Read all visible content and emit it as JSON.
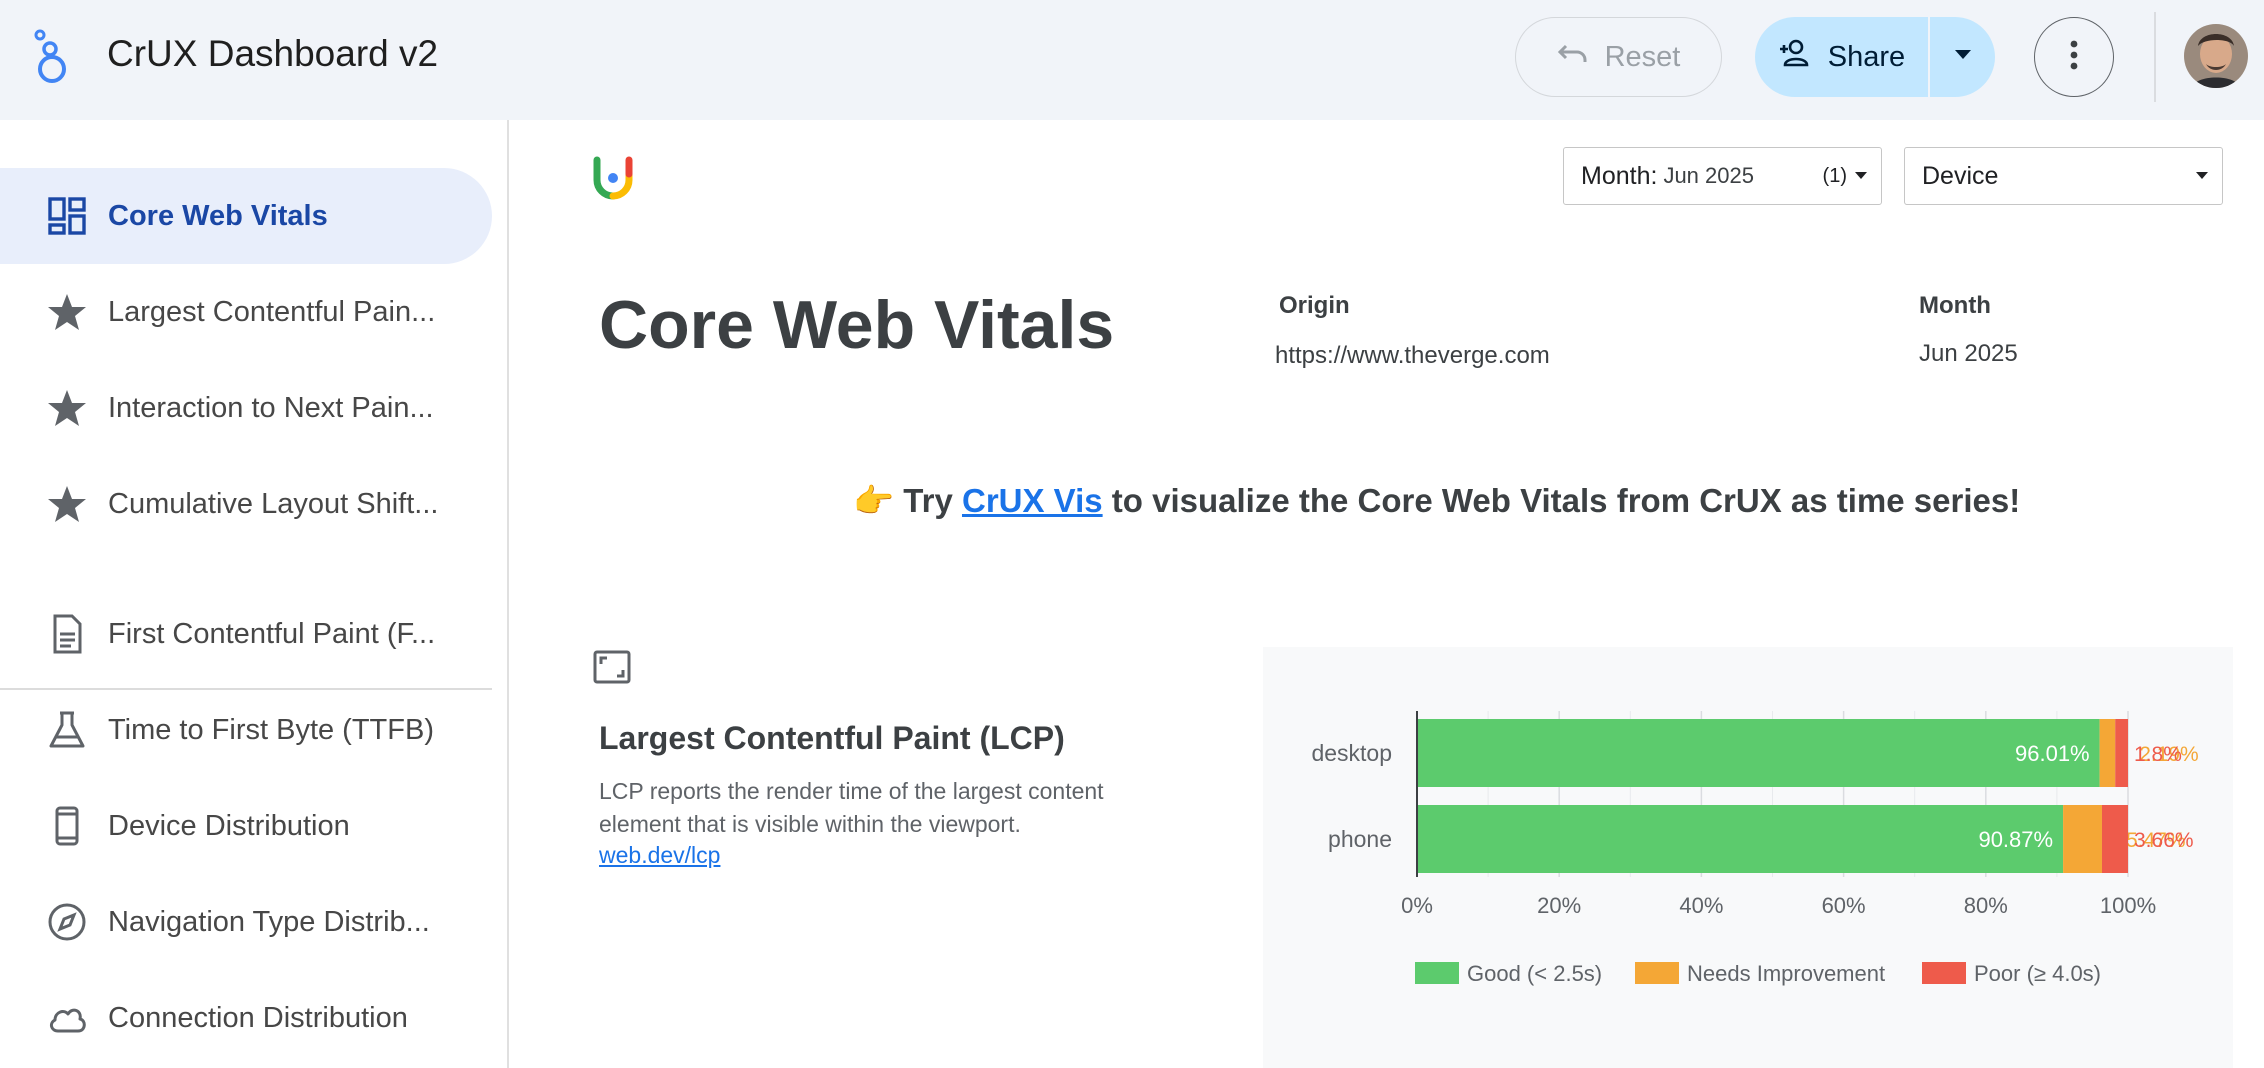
{
  "app": {
    "title": "CrUX Dashboard v2"
  },
  "toolbar": {
    "reset_label": "Reset",
    "share_label": "Share"
  },
  "sidebar": {
    "items": [
      {
        "label": "Core Web Vitals",
        "icon": "dashboard-icon",
        "active": true
      },
      {
        "label": "Largest Contentful Pain...",
        "icon": "star-icon"
      },
      {
        "label": "Interaction to Next Pain...",
        "icon": "star-icon"
      },
      {
        "label": "Cumulative Layout Shift...",
        "icon": "star-icon"
      },
      {
        "label": "First Contentful Paint (F...",
        "icon": "document-icon"
      },
      {
        "label": "Time to First Byte (TTFB)",
        "icon": "flask-icon"
      },
      {
        "label": "Device Distribution",
        "icon": "phone-icon"
      },
      {
        "label": "Navigation Type Distrib...",
        "icon": "compass-icon"
      },
      {
        "label": "Connection Distribution",
        "icon": "cloud-icon"
      }
    ]
  },
  "filters": {
    "month": {
      "label": "Month:",
      "value": "Jun 2025",
      "count": "(1)"
    },
    "device": {
      "label": "Device"
    }
  },
  "report": {
    "title": "Core Web Vitals",
    "origin_header": "Origin",
    "origin_value": "https://www.theverge.com",
    "month_header": "Month",
    "month_value": "Jun 2025",
    "promo_emoji": "👉",
    "promo_before": "Try",
    "promo_link": "CrUX Vis",
    "promo_after": "to visualize the Core Web Vitals from CrUX as time series!"
  },
  "metric": {
    "title": "Largest Contentful Paint (LCP)",
    "description": "LCP reports the render time of the largest content element that is visible within the viewport.",
    "link": "web.dev/lcp"
  },
  "chart_data": {
    "type": "bar",
    "orientation": "horizontal",
    "stacked": true,
    "categories": [
      "desktop",
      "phone"
    ],
    "series": [
      {
        "name": "Good (< 2.5s)",
        "values": [
          96.01,
          90.87
        ],
        "labels": [
          "96.01%",
          "90.87%"
        ],
        "color": "#5ccb6d"
      },
      {
        "name": "Needs Improvement",
        "values": [
          2.19,
          5.47
        ],
        "labels": [
          "2.19%",
          "5.47%"
        ],
        "color": "#f4a736"
      },
      {
        "name": "Poor (≥ 4.0s)",
        "values": [
          1.8,
          3.66
        ],
        "labels": [
          "1.8%",
          "3.66%"
        ],
        "color": "#ee5b4b"
      }
    ],
    "xlim": [
      0,
      100
    ],
    "x_ticks": [
      "0%",
      "20%",
      "40%",
      "60%",
      "80%",
      "100%"
    ],
    "grid": true,
    "legend": "bottom"
  }
}
